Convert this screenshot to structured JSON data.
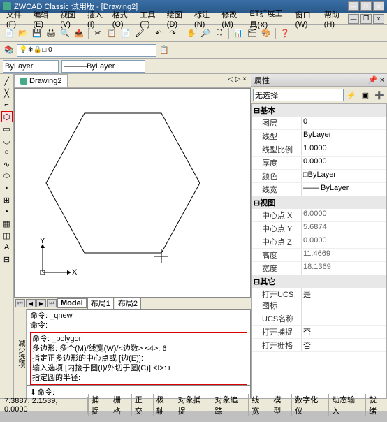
{
  "title": "ZWCAD Classic 试用版 - [Drawing2]",
  "menus": [
    "文件(F)",
    "编辑(E)",
    "视图(V)",
    "插入(I)",
    "格式(O)",
    "工具(T)",
    "绘图(D)",
    "标注(N)",
    "修改(M)",
    "ET扩展工具(X)",
    "窗口(W)",
    "帮助(H)"
  ],
  "doc_tab": "Drawing2",
  "bylayer1": "ByLayer",
  "bylayer2": "ByLayer",
  "model_tabs": {
    "model": "Model",
    "layout1": "布局1",
    "layout2": "布局2"
  },
  "cmd": {
    "label_left": "减少选项",
    "line1": "命令: _qnew",
    "line2": "命令:",
    "line3": "命令: _polygon",
    "line4": "多边形: 多个(M)/线宽(W)/<边数> <4>: 6",
    "line5": "指定正多边形的中心点或 [边(E)]:",
    "line6": "输入选项 [内接于圆(I)/外切于圆(C)] <I>: i",
    "line7": "指定圆的半径:",
    "prompt": "命令:"
  },
  "props": {
    "title": "属性",
    "selector": "无选择",
    "groups": {
      "basic": "基本",
      "view": "视图",
      "other": "其它"
    },
    "rows": {
      "layer": {
        "label": "图层",
        "value": "0"
      },
      "linetype": {
        "label": "线型",
        "value": "ByLayer"
      },
      "ltscale": {
        "label": "线型比例",
        "value": "1.0000"
      },
      "thickness": {
        "label": "厚度",
        "value": "0.0000"
      },
      "color": {
        "label": "颜色",
        "value": "□ByLayer"
      },
      "lineweight": {
        "label": "线宽",
        "value": "—— ByLayer"
      },
      "centerx": {
        "label": "中心点 X",
        "value": "6.0000"
      },
      "centery": {
        "label": "中心点 Y",
        "value": "5.6874"
      },
      "centerz": {
        "label": "中心点 Z",
        "value": "0.0000"
      },
      "height": {
        "label": "高度",
        "value": "11.4669"
      },
      "width": {
        "label": "宽度",
        "value": "18.1369"
      },
      "ucsicon": {
        "label": "打开UCS图标",
        "value": "是"
      },
      "ucsname": {
        "label": "UCS名称",
        "value": ""
      },
      "snap": {
        "label": "打开捕捉",
        "value": "否"
      },
      "grid": {
        "label": "打开栅格",
        "value": "否"
      }
    }
  },
  "status": {
    "coords": "7.3887, 2.1539, 0.0000",
    "toggles": [
      "捕捉",
      "栅格",
      "正交",
      "极轴",
      "对象捕捉",
      "对象追踪",
      "线宽",
      "模型",
      "数字化仪",
      "动态输入",
      "就绪"
    ]
  },
  "chart_data": {
    "type": "diagram",
    "shape": "hexagon",
    "sides": 6,
    "description": "Regular hexagon drawn in CAD canvas with X/Y axis indicator at bottom-left"
  }
}
